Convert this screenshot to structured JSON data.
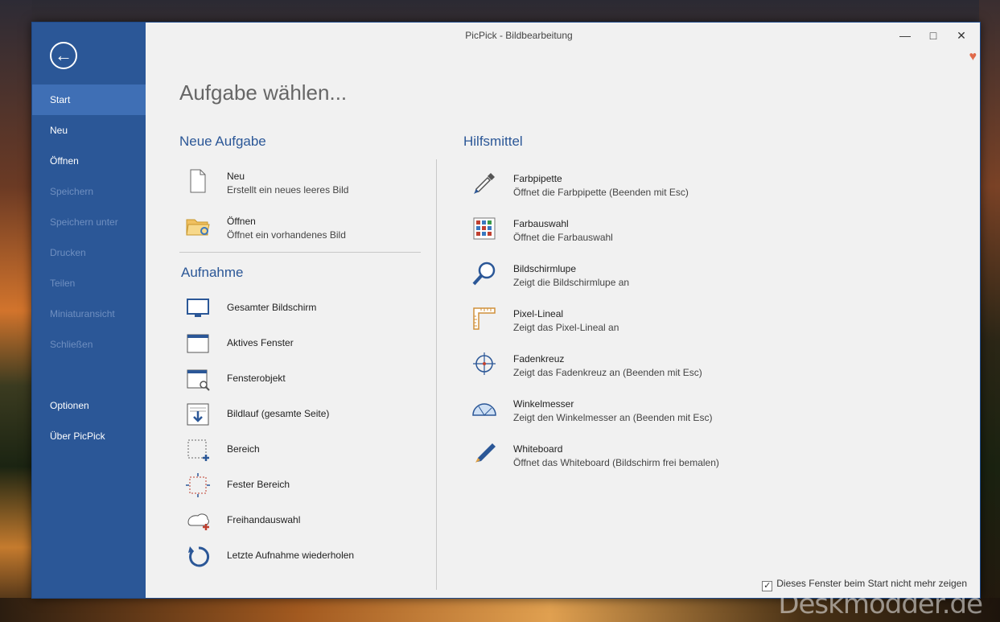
{
  "window": {
    "title": "PicPick - Bildbearbeitung"
  },
  "sidebar": {
    "items": [
      {
        "label": "Start",
        "state": "active"
      },
      {
        "label": "Neu",
        "state": "normal"
      },
      {
        "label": "Öffnen",
        "state": "normal"
      },
      {
        "label": "Speichern",
        "state": "disabled"
      },
      {
        "label": "Speichern unter",
        "state": "disabled"
      },
      {
        "label": "Drucken",
        "state": "disabled"
      },
      {
        "label": "Teilen",
        "state": "disabled"
      },
      {
        "label": "Miniaturansicht",
        "state": "disabled"
      },
      {
        "label": "Schließen",
        "state": "disabled"
      },
      {
        "label": "Optionen",
        "state": "normal"
      },
      {
        "label": "Über PicPick",
        "state": "normal"
      }
    ]
  },
  "main": {
    "heading": "Aufgabe wählen...",
    "new_task": {
      "title": "Neue Aufgabe",
      "items": [
        {
          "label": "Neu",
          "desc": "Erstellt ein neues leeres Bild",
          "icon": "new-file-icon"
        },
        {
          "label": "Öffnen",
          "desc": "Öffnet ein vorhandenes Bild",
          "icon": "open-folder-icon"
        }
      ]
    },
    "capture": {
      "title": "Aufnahme",
      "items": [
        {
          "label": "Gesamter Bildschirm",
          "icon": "monitor-icon"
        },
        {
          "label": "Aktives Fenster",
          "icon": "window-icon"
        },
        {
          "label": "Fensterobjekt",
          "icon": "window-object-icon"
        },
        {
          "label": "Bildlauf (gesamte Seite)",
          "icon": "scroll-capture-icon"
        },
        {
          "label": "Bereich",
          "icon": "region-icon"
        },
        {
          "label": "Fester Bereich",
          "icon": "fixed-region-icon"
        },
        {
          "label": "Freihandauswahl",
          "icon": "freehand-icon"
        },
        {
          "label": "Letzte Aufnahme wiederholen",
          "icon": "repeat-icon"
        }
      ]
    },
    "tools": {
      "title": "Hilfsmittel",
      "items": [
        {
          "label": "Farbpipette",
          "desc": "Öffnet die Farbpipette (Beenden mit Esc)",
          "icon": "eyedropper-icon"
        },
        {
          "label": "Farbauswahl",
          "desc": "Öffnet die Farbauswahl",
          "icon": "color-palette-icon"
        },
        {
          "label": "Bildschirmlupe",
          "desc": "Zeigt die Bildschirmlupe an",
          "icon": "magnifier-icon"
        },
        {
          "label": "Pixel-Lineal",
          "desc": "Zeigt das Pixel-Lineal an",
          "icon": "ruler-icon"
        },
        {
          "label": "Fadenkreuz",
          "desc": "Zeigt das Fadenkreuz an (Beenden mit Esc)",
          "icon": "crosshair-icon"
        },
        {
          "label": "Winkelmesser",
          "desc": "Zeigt den Winkelmesser an (Beenden mit Esc)",
          "icon": "protractor-icon"
        },
        {
          "label": "Whiteboard",
          "desc": "Öffnet das Whiteboard (Bildschirm frei bemalen)",
          "icon": "pen-icon"
        }
      ]
    },
    "footer": {
      "checkbox_label": "Dieses Fenster beim Start nicht mehr zeigen",
      "checked": true
    }
  },
  "watermark": "Deskmodder.de",
  "colors": {
    "sidebar": "#2b5797",
    "accent": "#2b5797",
    "active_item": "#3f6fb5"
  }
}
